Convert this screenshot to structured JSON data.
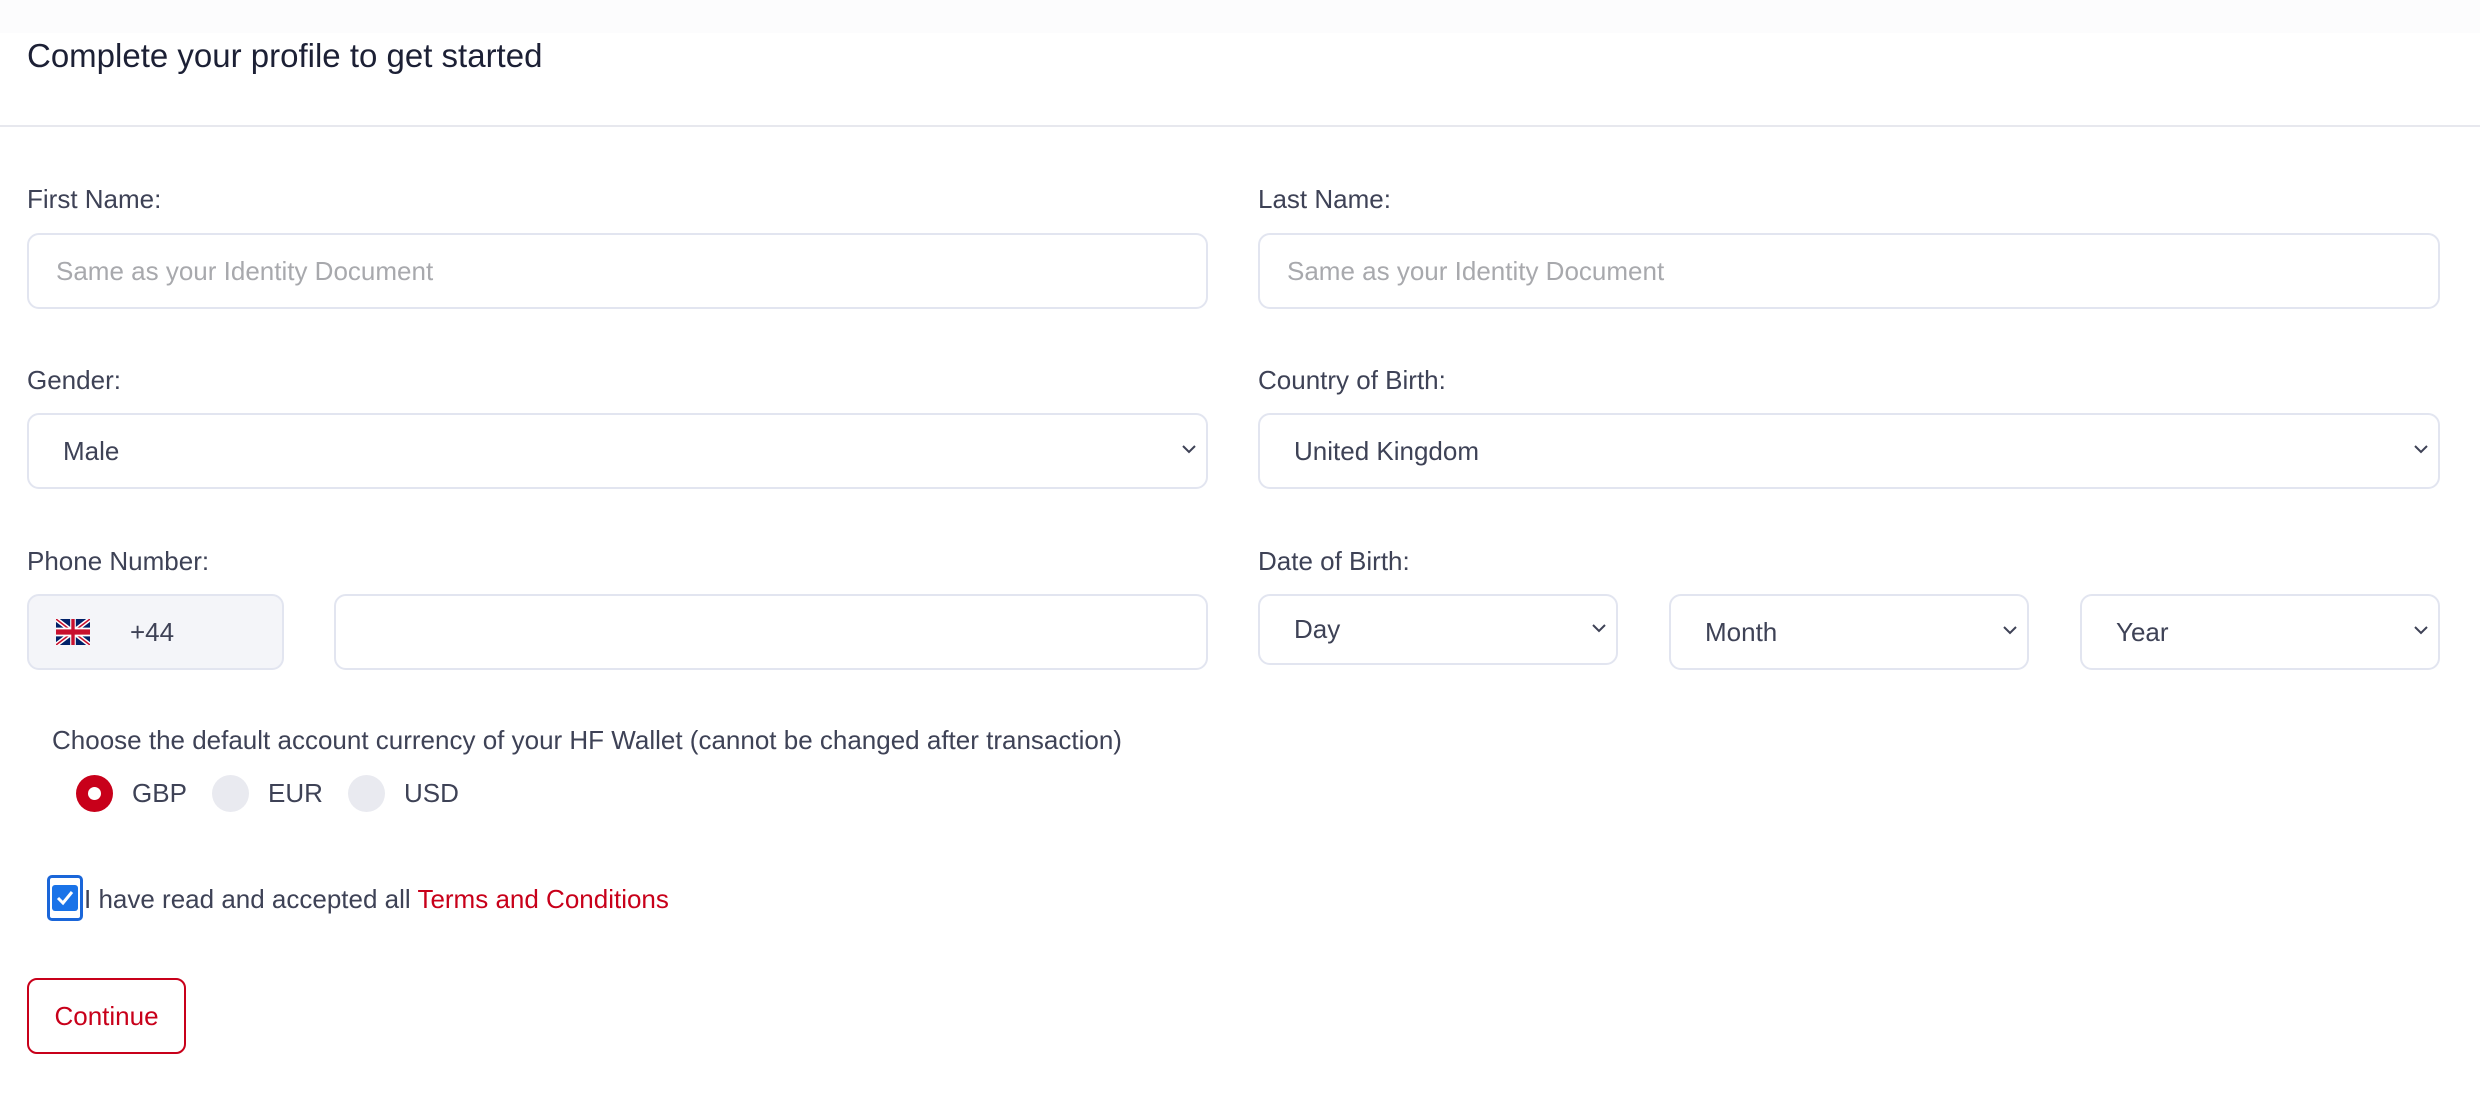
{
  "header": {
    "title": "Complete your profile to get started"
  },
  "form": {
    "first_name": {
      "label": "First Name:",
      "value": "",
      "placeholder": "Same as your Identity Document"
    },
    "last_name": {
      "label": "Last Name:",
      "value": "",
      "placeholder": "Same as your Identity Document"
    },
    "gender": {
      "label": "Gender:",
      "selected": "Male"
    },
    "country_of_birth": {
      "label": "Country of Birth:",
      "selected": "United Kingdom"
    },
    "phone": {
      "label": "Phone Number:",
      "country_flag_icon": "uk-flag-icon",
      "country_code": "+44",
      "number": ""
    },
    "date_of_birth": {
      "label": "Date of Birth:",
      "day": "Day",
      "month": "Month",
      "year": "Year"
    },
    "currency": {
      "prompt": "Choose the default account currency of your HF Wallet (cannot be changed after transaction)",
      "options": [
        {
          "label": "GBP",
          "checked": true
        },
        {
          "label": "EUR",
          "checked": false
        },
        {
          "label": "USD",
          "checked": false
        }
      ]
    },
    "terms": {
      "checked": true,
      "text": "I have read and accepted all ",
      "link_text": "Terms and Conditions"
    },
    "continue_label": "Continue"
  },
  "colors": {
    "accent": "#c8001a",
    "checkbox": "#1a73e8",
    "text": "#3e4256",
    "border": "#e2e5f0"
  }
}
